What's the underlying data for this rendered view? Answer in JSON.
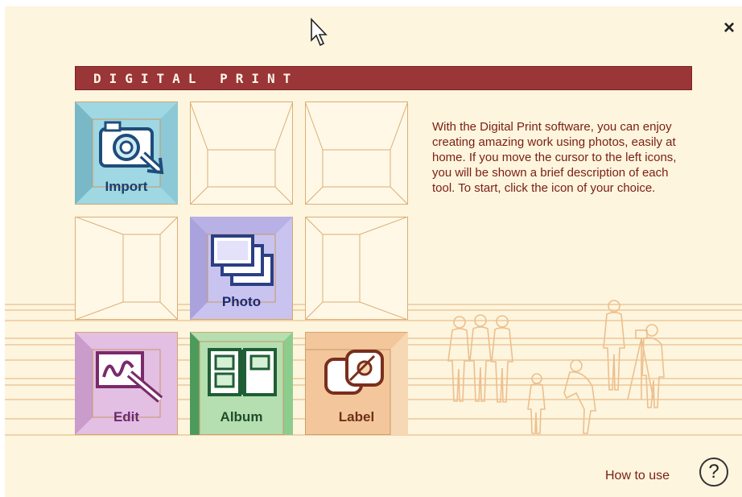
{
  "window": {
    "close_symbol": "×"
  },
  "header": {
    "title": "DIGITAL PRINT"
  },
  "tiles": [
    {
      "id": "import",
      "label": "Import",
      "icon": "camera-import-icon",
      "color": "#9fd7e3"
    },
    {
      "id": "photo",
      "label": "Photo",
      "icon": "photos-stack-icon",
      "color": "#c9c3ef"
    },
    {
      "id": "edit",
      "label": "Edit",
      "icon": "pen-drawing-icon",
      "color": "#e2bfe3"
    },
    {
      "id": "album",
      "label": "Album",
      "icon": "album-book-icon",
      "color": "#b5dfb1"
    },
    {
      "id": "label",
      "label": "Label",
      "icon": "disc-label-icon",
      "color": "#f3c79b"
    }
  ],
  "description": "With the Digital Print software, you can enjoy creating amazing work using photos, easily at home. If you move the cursor to the left icons, you will be shown a brief description of each tool. To start, click the icon of your choice.",
  "footer": {
    "how_to_use": "How to use",
    "help_symbol": "?"
  },
  "colors": {
    "background": "#fdf5de",
    "title_bar": "#9a3538",
    "text": "#7a1e14",
    "frame": "#e9b98a"
  }
}
